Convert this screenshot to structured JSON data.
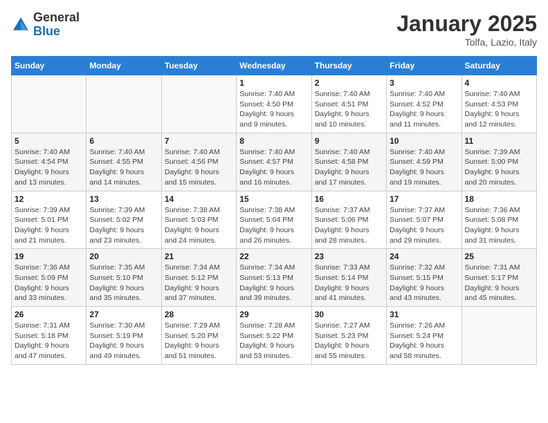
{
  "logo": {
    "general": "General",
    "blue": "Blue"
  },
  "title": "January 2025",
  "location": "Tolfa, Lazio, Italy",
  "days_header": [
    "Sunday",
    "Monday",
    "Tuesday",
    "Wednesday",
    "Thursday",
    "Friday",
    "Saturday"
  ],
  "weeks": [
    [
      {
        "day": "",
        "info": ""
      },
      {
        "day": "",
        "info": ""
      },
      {
        "day": "",
        "info": ""
      },
      {
        "day": "1",
        "info": "Sunrise: 7:40 AM\nSunset: 4:50 PM\nDaylight: 9 hours\nand 9 minutes."
      },
      {
        "day": "2",
        "info": "Sunrise: 7:40 AM\nSunset: 4:51 PM\nDaylight: 9 hours\nand 10 minutes."
      },
      {
        "day": "3",
        "info": "Sunrise: 7:40 AM\nSunset: 4:52 PM\nDaylight: 9 hours\nand 11 minutes."
      },
      {
        "day": "4",
        "info": "Sunrise: 7:40 AM\nSunset: 4:53 PM\nDaylight: 9 hours\nand 12 minutes."
      }
    ],
    [
      {
        "day": "5",
        "info": "Sunrise: 7:40 AM\nSunset: 4:54 PM\nDaylight: 9 hours\nand 13 minutes."
      },
      {
        "day": "6",
        "info": "Sunrise: 7:40 AM\nSunset: 4:55 PM\nDaylight: 9 hours\nand 14 minutes."
      },
      {
        "day": "7",
        "info": "Sunrise: 7:40 AM\nSunset: 4:56 PM\nDaylight: 9 hours\nand 15 minutes."
      },
      {
        "day": "8",
        "info": "Sunrise: 7:40 AM\nSunset: 4:57 PM\nDaylight: 9 hours\nand 16 minutes."
      },
      {
        "day": "9",
        "info": "Sunrise: 7:40 AM\nSunset: 4:58 PM\nDaylight: 9 hours\nand 17 minutes."
      },
      {
        "day": "10",
        "info": "Sunrise: 7:40 AM\nSunset: 4:59 PM\nDaylight: 9 hours\nand 19 minutes."
      },
      {
        "day": "11",
        "info": "Sunrise: 7:39 AM\nSunset: 5:00 PM\nDaylight: 9 hours\nand 20 minutes."
      }
    ],
    [
      {
        "day": "12",
        "info": "Sunrise: 7:39 AM\nSunset: 5:01 PM\nDaylight: 9 hours\nand 21 minutes."
      },
      {
        "day": "13",
        "info": "Sunrise: 7:39 AM\nSunset: 5:02 PM\nDaylight: 9 hours\nand 23 minutes."
      },
      {
        "day": "14",
        "info": "Sunrise: 7:38 AM\nSunset: 5:03 PM\nDaylight: 9 hours\nand 24 minutes."
      },
      {
        "day": "15",
        "info": "Sunrise: 7:38 AM\nSunset: 5:04 PM\nDaylight: 9 hours\nand 26 minutes."
      },
      {
        "day": "16",
        "info": "Sunrise: 7:37 AM\nSunset: 5:06 PM\nDaylight: 9 hours\nand 28 minutes."
      },
      {
        "day": "17",
        "info": "Sunrise: 7:37 AM\nSunset: 5:07 PM\nDaylight: 9 hours\nand 29 minutes."
      },
      {
        "day": "18",
        "info": "Sunrise: 7:36 AM\nSunset: 5:08 PM\nDaylight: 9 hours\nand 31 minutes."
      }
    ],
    [
      {
        "day": "19",
        "info": "Sunrise: 7:36 AM\nSunset: 5:09 PM\nDaylight: 9 hours\nand 33 minutes."
      },
      {
        "day": "20",
        "info": "Sunrise: 7:35 AM\nSunset: 5:10 PM\nDaylight: 9 hours\nand 35 minutes."
      },
      {
        "day": "21",
        "info": "Sunrise: 7:34 AM\nSunset: 5:12 PM\nDaylight: 9 hours\nand 37 minutes."
      },
      {
        "day": "22",
        "info": "Sunrise: 7:34 AM\nSunset: 5:13 PM\nDaylight: 9 hours\nand 39 minutes."
      },
      {
        "day": "23",
        "info": "Sunrise: 7:33 AM\nSunset: 5:14 PM\nDaylight: 9 hours\nand 41 minutes."
      },
      {
        "day": "24",
        "info": "Sunrise: 7:32 AM\nSunset: 5:15 PM\nDaylight: 9 hours\nand 43 minutes."
      },
      {
        "day": "25",
        "info": "Sunrise: 7:31 AM\nSunset: 5:17 PM\nDaylight: 9 hours\nand 45 minutes."
      }
    ],
    [
      {
        "day": "26",
        "info": "Sunrise: 7:31 AM\nSunset: 5:18 PM\nDaylight: 9 hours\nand 47 minutes."
      },
      {
        "day": "27",
        "info": "Sunrise: 7:30 AM\nSunset: 5:19 PM\nDaylight: 9 hours\nand 49 minutes."
      },
      {
        "day": "28",
        "info": "Sunrise: 7:29 AM\nSunset: 5:20 PM\nDaylight: 9 hours\nand 51 minutes."
      },
      {
        "day": "29",
        "info": "Sunrise: 7:28 AM\nSunset: 5:22 PM\nDaylight: 9 hours\nand 53 minutes."
      },
      {
        "day": "30",
        "info": "Sunrise: 7:27 AM\nSunset: 5:23 PM\nDaylight: 9 hours\nand 55 minutes."
      },
      {
        "day": "31",
        "info": "Sunrise: 7:26 AM\nSunset: 5:24 PM\nDaylight: 9 hours\nand 58 minutes."
      },
      {
        "day": "",
        "info": ""
      }
    ]
  ]
}
